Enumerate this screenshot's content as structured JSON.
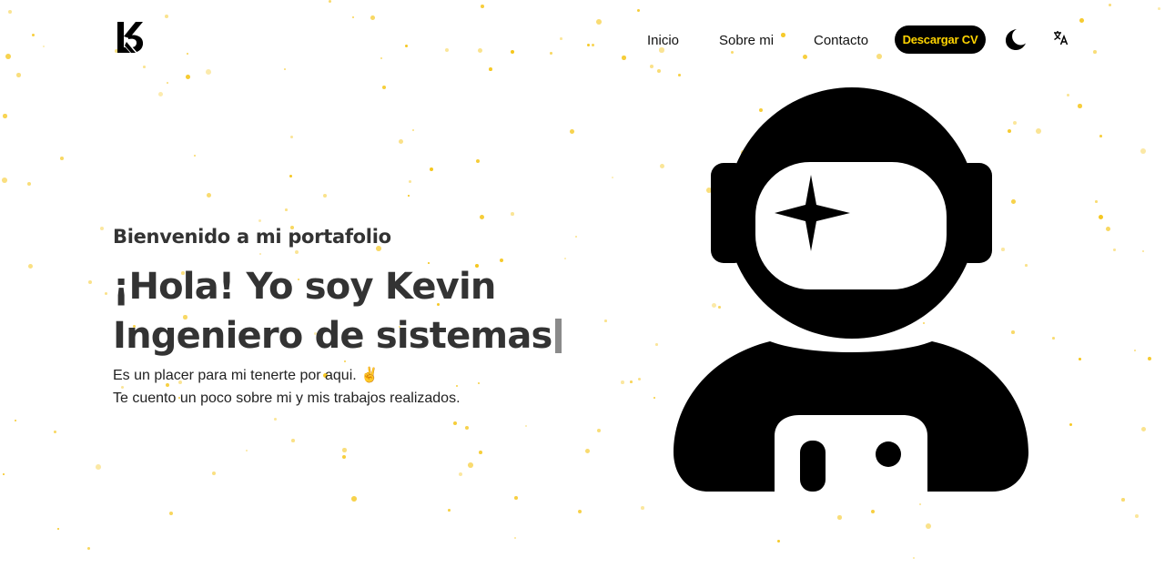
{
  "header": {
    "logo_icon": "kevin-monogram-logo",
    "nav": [
      {
        "label": "Inicio"
      },
      {
        "label": "Sobre mi"
      },
      {
        "label": "Contacto"
      }
    ],
    "cv_button_label": "Descargar CV",
    "theme_toggle_icon": "moon-icon",
    "language_toggle_icon": "translate-icon"
  },
  "hero": {
    "welcome": "Bienvenido a mi portafolio",
    "title_line1": "¡Hola! Yo soy Kevin",
    "title_line2": "Ingeniero de sistemas",
    "description_line1": "Es un placer para mi tenerte por aqui. ✌️",
    "description_line2": "Te cuento un poco sobre mi y mis trabajos realizados."
  },
  "illustration": {
    "icon": "astronaut-icon"
  },
  "colors": {
    "accent": "#f5c518",
    "button_bg": "#000000",
    "button_text": "#ffd400",
    "text": "#333333"
  }
}
